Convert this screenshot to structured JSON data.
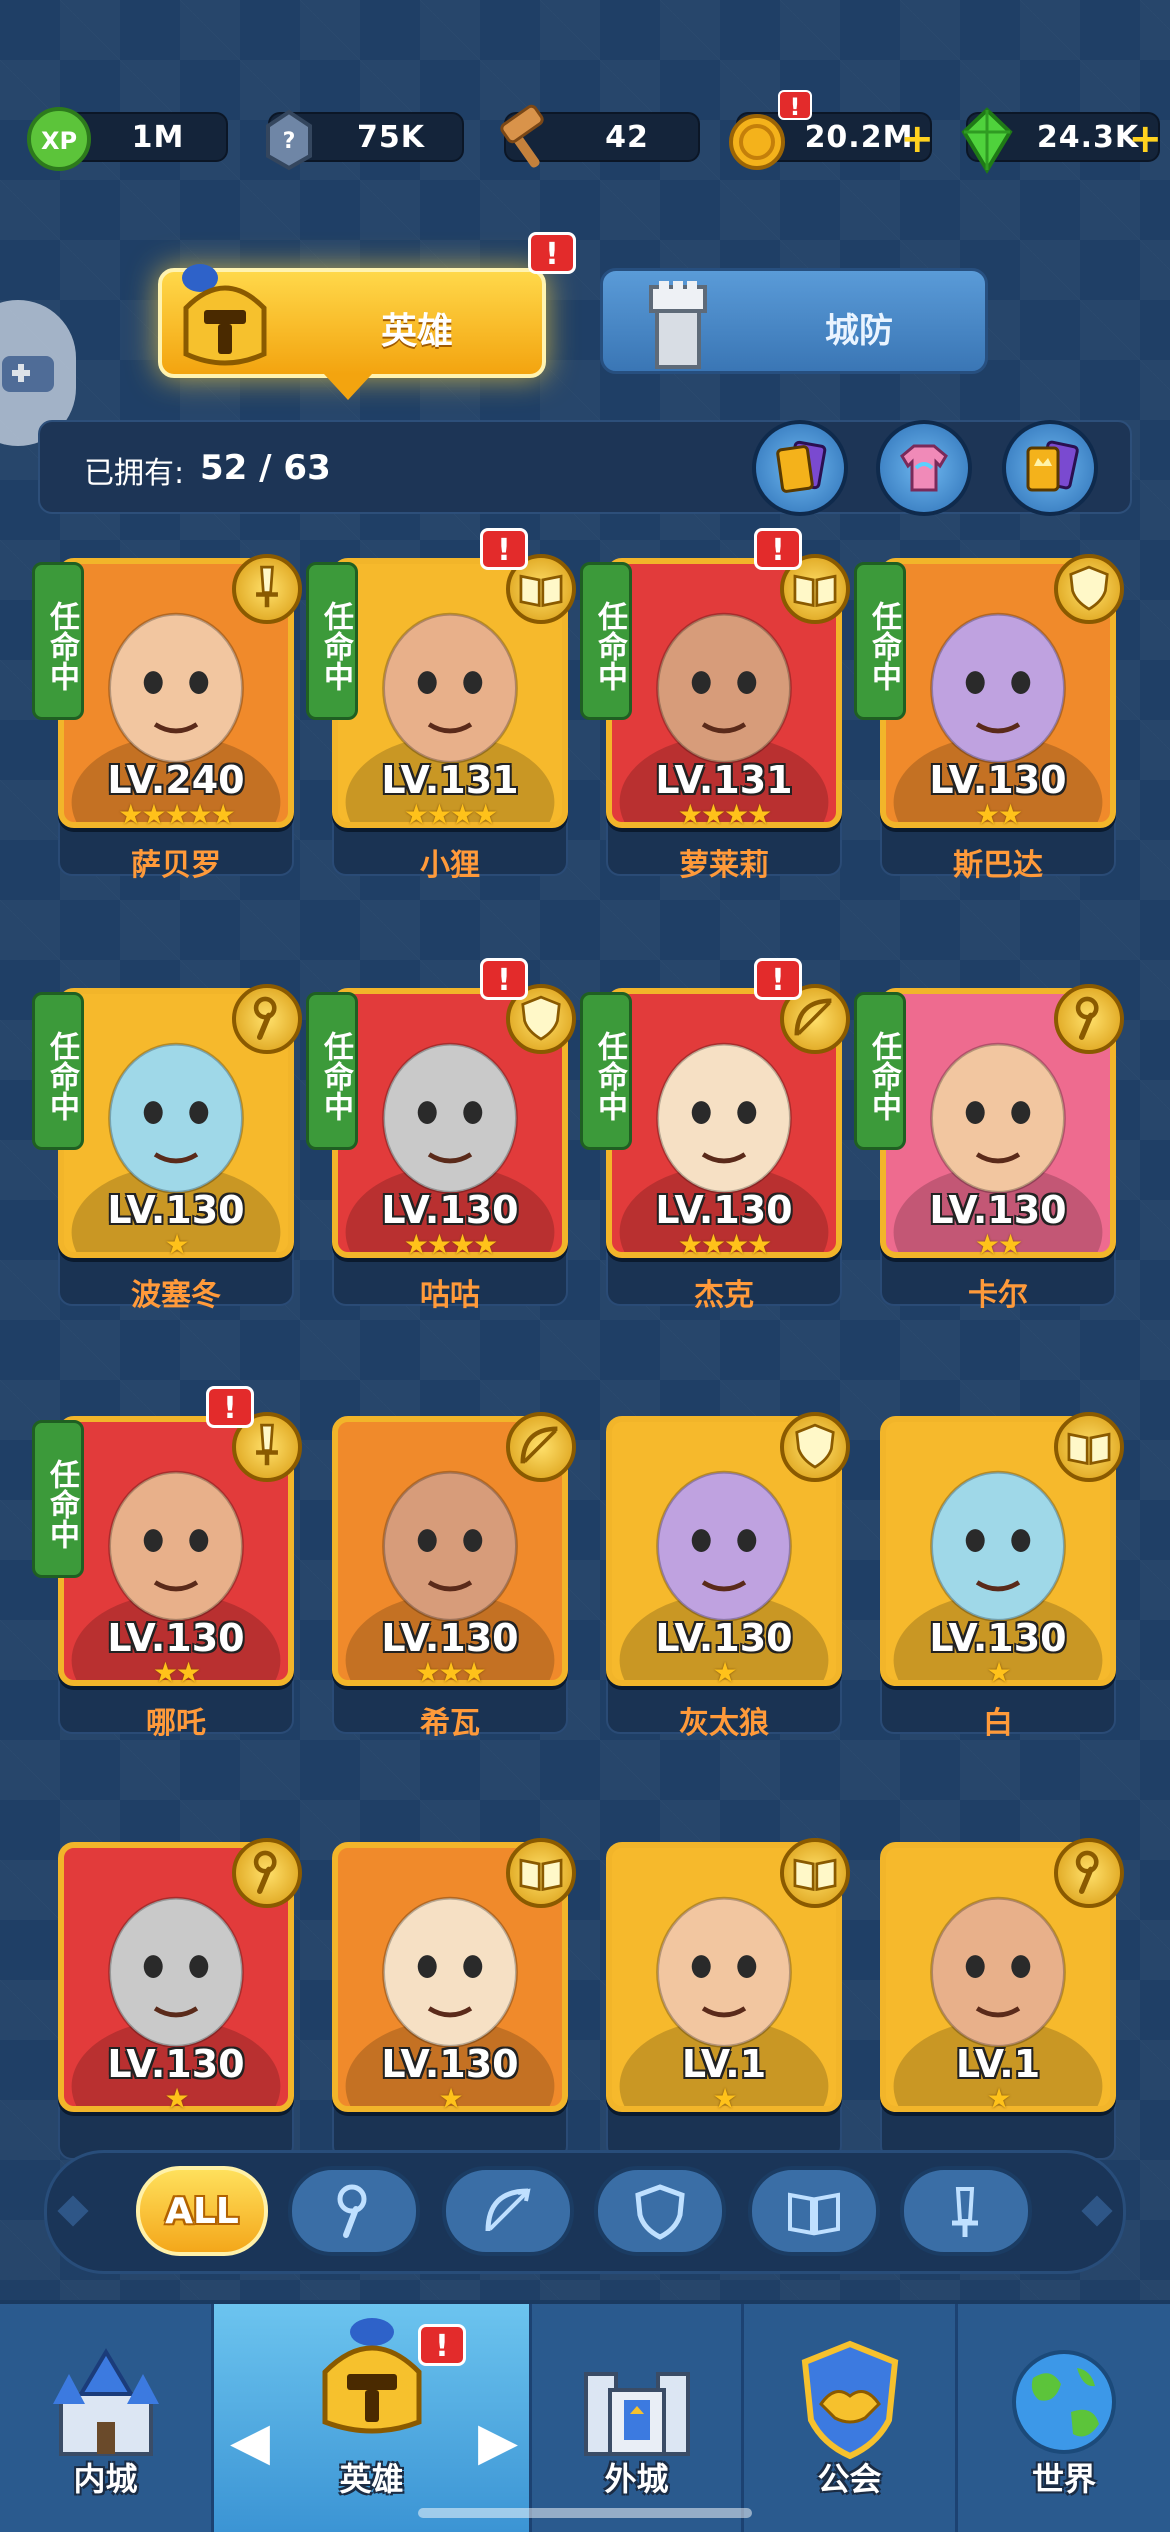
{
  "resources": [
    {
      "name": "exp",
      "icon": "exp-icon",
      "value": "1M",
      "has_plus": false,
      "warn": false
    },
    {
      "name": "stone",
      "icon": "stone-icon",
      "value": "75K",
      "has_plus": false,
      "warn": false
    },
    {
      "name": "hammer",
      "icon": "hammer-icon",
      "value": "42",
      "has_plus": false,
      "warn": false
    },
    {
      "name": "gold",
      "icon": "gold-coin-icon",
      "value": "20.2M",
      "has_plus": true,
      "warn": true
    },
    {
      "name": "gems",
      "icon": "gem-icon",
      "value": "24.3K",
      "has_plus": true,
      "warn": false
    }
  ],
  "tabs": {
    "heroes": "英雄",
    "defense": "城防",
    "warn": "!"
  },
  "owned": {
    "label": "已拥有:",
    "count": "52 / 63"
  },
  "heroes": [
    {
      "name": "萨贝罗",
      "level": "LV.240",
      "stars": "★★★★★",
      "assigned": true,
      "assigned_label": "任命中",
      "class": "sword",
      "warn": false,
      "bg": "orange"
    },
    {
      "name": "小狸",
      "level": "LV.131",
      "stars": "★★★★",
      "assigned": true,
      "assigned_label": "任命中",
      "class": "book",
      "warn": true,
      "bg": "yellow"
    },
    {
      "name": "萝莱莉",
      "level": "LV.131",
      "stars": "★★★★",
      "assigned": true,
      "assigned_label": "任命中",
      "class": "book",
      "warn": true,
      "bg": "red"
    },
    {
      "name": "斯巴达",
      "level": "LV.130",
      "stars": "★★",
      "assigned": true,
      "assigned_label": "任命中",
      "class": "shield",
      "warn": false,
      "bg": "orange"
    },
    {
      "name": "波塞冬",
      "level": "LV.130",
      "stars": "★",
      "assigned": true,
      "assigned_label": "任命中",
      "class": "staff",
      "warn": false,
      "bg": "yellow"
    },
    {
      "name": "咕咕",
      "level": "LV.130",
      "stars": "★★★★",
      "assigned": true,
      "assigned_label": "任命中",
      "class": "shield",
      "warn": true,
      "bg": "red"
    },
    {
      "name": "杰克",
      "level": "LV.130",
      "stars": "★★★★",
      "assigned": true,
      "assigned_label": "任命中",
      "class": "bow",
      "warn": true,
      "bg": "red"
    },
    {
      "name": "卡尔",
      "level": "LV.130",
      "stars": "★★",
      "assigned": true,
      "assigned_label": "任命中",
      "class": "staff",
      "warn": false,
      "bg": "pink"
    },
    {
      "name": "哪吒",
      "level": "LV.130",
      "stars": "★★",
      "assigned": true,
      "assigned_label": "任命中",
      "class": "sword",
      "warn": true,
      "bg": "red"
    },
    {
      "name": "希瓦",
      "level": "LV.130",
      "stars": "★★★",
      "assigned": false,
      "assigned_label": "",
      "class": "bow",
      "warn": false,
      "bg": "orange"
    },
    {
      "name": "灰太狼",
      "level": "LV.130",
      "stars": "★",
      "assigned": false,
      "assigned_label": "",
      "class": "shield",
      "warn": false,
      "bg": "yellow"
    },
    {
      "name": "白",
      "level": "LV.130",
      "stars": "★",
      "assigned": false,
      "assigned_label": "",
      "class": "book",
      "warn": false,
      "bg": "yellow"
    },
    {
      "name": "",
      "level": "LV.130",
      "stars": "★",
      "assigned": false,
      "assigned_label": "",
      "class": "staff",
      "warn": false,
      "bg": "red"
    },
    {
      "name": "",
      "level": "LV.130",
      "stars": "★",
      "assigned": false,
      "assigned_label": "",
      "class": "book",
      "warn": false,
      "bg": "orange"
    },
    {
      "name": "",
      "level": "LV.1",
      "stars": "★",
      "assigned": false,
      "assigned_label": "",
      "class": "book",
      "warn": false,
      "bg": "yellow"
    },
    {
      "name": "",
      "level": "LV.1",
      "stars": "★",
      "assigned": false,
      "assigned_label": "",
      "class": "staff",
      "warn": false,
      "bg": "yellow"
    }
  ],
  "filters": [
    {
      "name": "all",
      "label": "ALL",
      "icon": "all-icon",
      "active": true
    },
    {
      "name": "staff",
      "label": "",
      "icon": "staff-icon",
      "active": false
    },
    {
      "name": "bow",
      "label": "",
      "icon": "bow-icon",
      "active": false
    },
    {
      "name": "shield",
      "label": "",
      "icon": "shield-icon",
      "active": false
    },
    {
      "name": "book",
      "label": "",
      "icon": "book-icon",
      "active": false
    },
    {
      "name": "sword",
      "label": "",
      "icon": "sword-icon",
      "active": false
    }
  ],
  "nav": [
    {
      "name": "inner-city",
      "label": "内城",
      "icon": "castle-icon",
      "active": false
    },
    {
      "name": "heroes",
      "label": "英雄",
      "icon": "helmet-icon",
      "active": true,
      "warn": "!"
    },
    {
      "name": "outer-city",
      "label": "外城",
      "icon": "fortress-icon",
      "active": false
    },
    {
      "name": "guild",
      "label": "公会",
      "icon": "handshake-icon",
      "active": false
    },
    {
      "name": "world",
      "label": "世界",
      "icon": "globe-icon",
      "active": false
    }
  ],
  "colors": {
    "background": "#1f3f66",
    "accent_gold": "#f6b92c",
    "assigned_green": "#3c9a3a",
    "warn_red": "#e32b2b",
    "hero_name": "#ff9a3a"
  }
}
